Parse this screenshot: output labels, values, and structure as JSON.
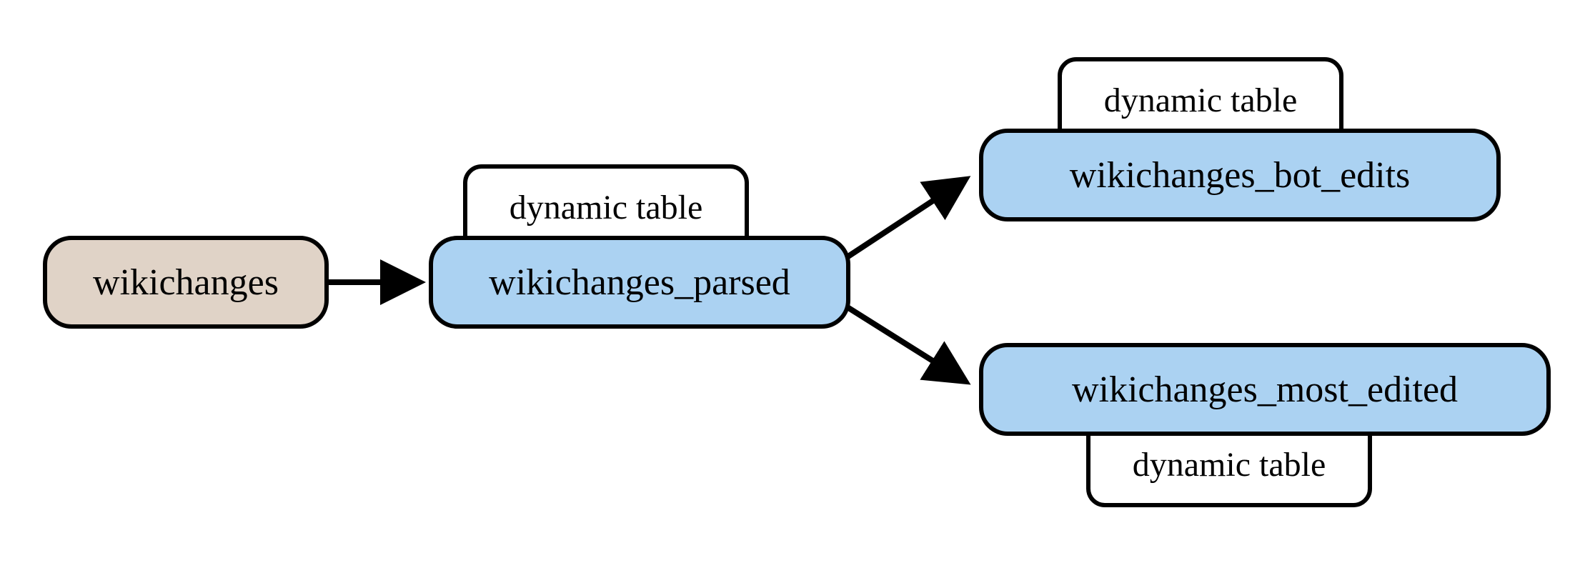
{
  "nodes": {
    "wikichanges": {
      "label": "wikichanges"
    },
    "wikichanges_parsed": {
      "label": "wikichanges_parsed",
      "tag": "dynamic table"
    },
    "wikichanges_bot_edits": {
      "label": "wikichanges_bot_edits",
      "tag": "dynamic table"
    },
    "wikichanges_most_edited": {
      "label": "wikichanges_most_edited",
      "tag": "dynamic table"
    }
  },
  "edges": [
    {
      "from": "wikichanges",
      "to": "wikichanges_parsed"
    },
    {
      "from": "wikichanges_parsed",
      "to": "wikichanges_bot_edits"
    },
    {
      "from": "wikichanges_parsed",
      "to": "wikichanges_most_edited"
    }
  ],
  "diagram": {
    "type": "flow",
    "description": "Data flow from wikichanges source into a parsed dynamic table, which then feeds two downstream dynamic tables: wikichanges_bot_edits and wikichanges_most_edited."
  }
}
